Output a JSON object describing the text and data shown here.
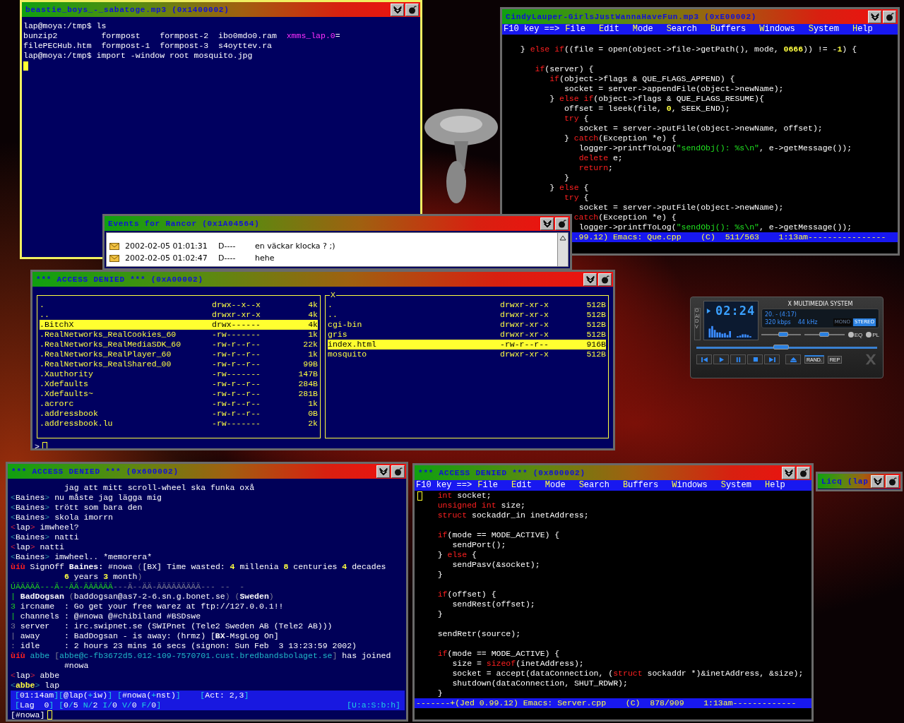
{
  "windows": [
    {
      "kind": "terminal",
      "title": "beastie_boys_-_sabatoge.mp3 (0x1400002)",
      "focused": true,
      "cursor": true,
      "lines": [
        {
          "parts": [
            {
              "kind": "plain",
              "text": "lap@moya:/tmp$ ls"
            }
          ]
        },
        {
          "parts": [
            {
              "kind": "plain",
              "text": "bunzip2         formpost    formpost-2  ibo0mdo0.ram  "
            },
            {
              "kind": "magenta",
              "text": "xmms_lap.0"
            },
            {
              "kind": "plain",
              "text": "="
            }
          ]
        },
        {
          "parts": [
            {
              "kind": "plain",
              "text": "filePECHub.htm  formpost-1  formpost-3  s4oyttev.ra"
            }
          ]
        },
        {
          "parts": [
            {
              "kind": "plain",
              "text": "lap@moya:/tmp$ import -window root mosquito.jpg"
            }
          ]
        }
      ]
    },
    {
      "kind": "editor",
      "title": "CindyLauper-GirlsJustWannaHaveFun.mp3 (0xE00002)",
      "focused": false,
      "menu_prefix": "F10 key ==>",
      "menu": [
        "File",
        "Edit",
        "Mode",
        "Search",
        "Buffers",
        "Windows",
        "System",
        "Help"
      ],
      "lines": [
        {
          "parts": [
            {
              "kind": "plain",
              "text": "  } "
            },
            {
              "kind": "kw",
              "text": "else if"
            },
            {
              "kind": "plain",
              "text": "((file = open(object->file->getPath(), mode, "
            },
            {
              "kind": "num",
              "text": "0666"
            },
            {
              "kind": "plain",
              "text": ")) != -"
            },
            {
              "kind": "num",
              "text": "1"
            },
            {
              "kind": "plain",
              "text": ") {"
            }
          ]
        },
        {
          "gap": true,
          "parts": [
            {
              "kind": "kw",
              "text": "     if"
            },
            {
              "kind": "plain",
              "text": "(server) {"
            }
          ]
        },
        {
          "parts": [
            {
              "kind": "kw",
              "text": "        if"
            },
            {
              "kind": "plain",
              "text": "(object->flags & QUE_FLAGS_APPEND) {"
            }
          ]
        },
        {
          "parts": [
            {
              "kind": "plain",
              "text": "           socket = server->appendFile(object->newName);"
            }
          ]
        },
        {
          "parts": [
            {
              "kind": "plain",
              "text": "        } "
            },
            {
              "kind": "kw",
              "text": "else if"
            },
            {
              "kind": "plain",
              "text": "(object->flags & QUE_FLAGS_RESUME){"
            }
          ]
        },
        {
          "parts": [
            {
              "kind": "plain",
              "text": "           offset = lseek(file, "
            },
            {
              "kind": "num",
              "text": "0"
            },
            {
              "kind": "plain",
              "text": ", SEEK_END);"
            }
          ]
        },
        {
          "parts": [
            {
              "kind": "kw",
              "text": "           try"
            },
            {
              "kind": "plain",
              "text": " {"
            }
          ]
        },
        {
          "parts": [
            {
              "kind": "plain",
              "text": "              socket = server->putFile(object->newName, offset);"
            }
          ]
        },
        {
          "parts": [
            {
              "kind": "plain",
              "text": "           } "
            },
            {
              "kind": "kw",
              "text": "catch"
            },
            {
              "kind": "plain",
              "text": "(Exception *e) {"
            }
          ]
        },
        {
          "parts": [
            {
              "kind": "plain",
              "text": "              logger->printfToLog("
            },
            {
              "kind": "str",
              "text": "\"sendObj(): %s\\n\""
            },
            {
              "kind": "plain",
              "text": ", e->getMessage());"
            }
          ]
        },
        {
          "parts": [
            {
              "kind": "kw",
              "text": "              delete"
            },
            {
              "kind": "plain",
              "text": " e;"
            }
          ]
        },
        {
          "parts": [
            {
              "kind": "kw",
              "text": "              return"
            },
            {
              "kind": "plain",
              "text": ";"
            }
          ]
        },
        {
          "parts": [
            {
              "kind": "plain",
              "text": "           }"
            }
          ]
        },
        {
          "parts": [
            {
              "kind": "plain",
              "text": "        } "
            },
            {
              "kind": "kw",
              "text": "else"
            },
            {
              "kind": "plain",
              "text": " {"
            }
          ]
        },
        {
          "parts": [
            {
              "kind": "kw",
              "text": "           try"
            },
            {
              "kind": "plain",
              "text": " {"
            }
          ]
        },
        {
          "parts": [
            {
              "kind": "plain",
              "text": "              socket = server->putFile(object->newName);"
            }
          ]
        },
        {
          "parts": [
            {
              "kind": "kw",
              "text": "             catch"
            },
            {
              "kind": "plain",
              "text": "(Exception *e) {"
            }
          ]
        },
        {
          "parts": [
            {
              "kind": "plain",
              "text": "              logger->printfToLog("
            },
            {
              "kind": "str",
              "text": "\"sendObj(): %s\\n\""
            },
            {
              "kind": "plain",
              "text": ", e->getMessage());"
            }
          ]
        }
      ],
      "status": "             .99.12) Emacs: Que.cpp    (C)  511/563    1:13am----------------"
    },
    {
      "kind": "events",
      "title": "Events for Rancor (0x1A04564)",
      "focused": false,
      "rows": [
        {
          "date": "2002-02-05 01:01:31",
          "flags": "D----",
          "message": "en väckar klocka ? ;)",
          "selected": false
        },
        {
          "date": "2002-02-05 01:02:47",
          "flags": "D----",
          "message": "hehe",
          "selected": false
        }
      ]
    },
    {
      "kind": "filemanager",
      "title": "*** ACCESS DENIED *** (0xA00002)",
      "focused": false,
      "cursor": true,
      "prompt": ">",
      "panels": [
        {
          "rows": [
            {
              "name": ".",
              "perms": "drwx--x--x",
              "size": "4k",
              "selected": false
            },
            {
              "name": "..",
              "perms": "drwxr-xr-x",
              "size": "4k",
              "selected": false
            },
            {
              "name": ".BitchX",
              "perms": "drwx------",
              "size": "4k",
              "selected": true
            },
            {
              "name": ".RealNetworks_RealCookies_60",
              "perms": "-rw-------",
              "size": "1k",
              "selected": false
            },
            {
              "name": ".RealNetworks_RealMediaSDK_60",
              "perms": "-rw-r--r--",
              "size": "22k",
              "selected": false
            },
            {
              "name": ".RealNetworks_RealPlayer_60",
              "perms": "-rw-r--r--",
              "size": "1k",
              "selected": false
            },
            {
              "name": ".RealNetworks_RealShared_00",
              "perms": "-rw-r--r--",
              "size": "99B",
              "selected": false
            },
            {
              "name": ".Xauthority",
              "perms": "-rw-------",
              "size": "147B",
              "selected": false
            },
            {
              "name": ".Xdefaults",
              "perms": "-rw-r--r--",
              "size": "284B",
              "selected": false
            },
            {
              "name": ".Xdefaults~",
              "perms": "-rw-r--r--",
              "size": "281B",
              "selected": false
            },
            {
              "name": ".acrorc",
              "perms": "-rw-r--r--",
              "size": "1k",
              "selected": false
            },
            {
              "name": ".addressbook",
              "perms": "-rw-r--r--",
              "size": "0B",
              "selected": false
            },
            {
              "name": ".addressbook.lu",
              "perms": "-rw-------",
              "size": "2k",
              "selected": false
            }
          ]
        },
        {
          "title": "X",
          "rows": [
            {
              "name": ".",
              "perms": "drwxr-xr-x",
              "size": "512B",
              "selected": false
            },
            {
              "name": "..",
              "perms": "drwxr-xr-x",
              "size": "512B",
              "selected": false
            },
            {
              "name": "cgi-bin",
              "perms": "drwxr-xr-x",
              "size": "512B",
              "selected": false
            },
            {
              "name": "gris",
              "perms": "drwxr-xr-x",
              "size": "512B",
              "selected": false
            },
            {
              "name": "index.html",
              "perms": "-rw-r--r--",
              "size": "916B",
              "selected": true
            },
            {
              "name": "mosquito",
              "perms": "drwxr-xr-x",
              "size": "512B",
              "selected": false
            }
          ]
        }
      ]
    },
    {
      "kind": "player",
      "title": "X MULTIMEDIA SYSTEM",
      "side_label": "OAIDV",
      "time": "02:24",
      "track": "20.  -  (4:17)",
      "bitrate": "320 kbps",
      "samplerate": "44 kHz",
      "modes": [
        {
          "label": "MONO",
          "on": false
        },
        {
          "label": "STEREO",
          "on": true
        }
      ],
      "sliders": [
        {
          "kind": "volume",
          "level": 0.55
        },
        {
          "kind": "balance",
          "level": 0.5
        },
        {
          "kind": "seek",
          "level": 0.47
        }
      ],
      "toggles": [
        {
          "label": "EQ",
          "on": false
        },
        {
          "label": "PL",
          "on": false
        }
      ],
      "switches": [
        {
          "label": "RAND.",
          "on": true
        },
        {
          "label": "REP",
          "on": false
        }
      ]
    },
    {
      "kind": "irc",
      "title": "*** ACCESS DENIED *** (0x600002)",
      "focused": false,
      "cursor": true,
      "lines": [
        {
          "parts": [
            {
              "kind": "plain",
              "text": "           jag att mitt scroll-wheel ska funka oxå"
            }
          ]
        },
        {
          "parts": [
            {
              "kind": "bracket",
              "text": "<"
            },
            {
              "kind": "plain",
              "text": "Baines"
            },
            {
              "kind": "bracket",
              "text": ">"
            },
            {
              "kind": "plain",
              "text": " nu måste jag lägga mig"
            }
          ]
        },
        {
          "parts": [
            {
              "kind": "bracket",
              "text": "<"
            },
            {
              "kind": "plain",
              "text": "Baines"
            },
            {
              "kind": "bracket",
              "text": ">"
            },
            {
              "kind": "plain",
              "text": " trött som bara den"
            }
          ]
        },
        {
          "parts": [
            {
              "kind": "bracket",
              "text": "<"
            },
            {
              "kind": "plain",
              "text": "Baines"
            },
            {
              "kind": "bracket",
              "text": ">"
            },
            {
              "kind": "plain",
              "text": " skola imorrn"
            }
          ]
        },
        {
          "parts": [
            {
              "kind": "mebracket",
              "text": "<"
            },
            {
              "kind": "plain",
              "text": "lap"
            },
            {
              "kind": "mebracket",
              "text": ">"
            },
            {
              "kind": "plain",
              "text": " imwheel?"
            }
          ]
        },
        {
          "parts": [
            {
              "kind": "bracket",
              "text": "<"
            },
            {
              "kind": "plain",
              "text": "Baines"
            },
            {
              "kind": "bracket",
              "text": ">"
            },
            {
              "kind": "plain",
              "text": " natti"
            }
          ]
        },
        {
          "parts": [
            {
              "kind": "mebracket",
              "text": "<"
            },
            {
              "kind": "plain",
              "text": "lap"
            },
            {
              "kind": "mebracket",
              "text": ">"
            },
            {
              "kind": "plain",
              "text": " natti"
            }
          ]
        },
        {
          "parts": [
            {
              "kind": "bracket",
              "text": "<"
            },
            {
              "kind": "plain",
              "text": "Baines"
            },
            {
              "kind": "bracket",
              "text": ">"
            },
            {
              "kind": "plain",
              "text": " imwheel.. *memorera*"
            }
          ]
        },
        {
          "parts": [
            {
              "kind": "alert",
              "text": "ùíù"
            },
            {
              "kind": "plain",
              "text": " SignOff "
            },
            {
              "kind": "bold",
              "text": "Baines:"
            },
            {
              "kind": "plain",
              "text": " #nowa "
            },
            {
              "kind": "dim",
              "text": "("
            },
            {
              "kind": "plain",
              "text": "[BX] Time wasted: "
            },
            {
              "kind": "num",
              "text": "4"
            },
            {
              "kind": "plain",
              "text": " millenia "
            },
            {
              "kind": "num",
              "text": "8"
            },
            {
              "kind": "plain",
              "text": " centuries "
            },
            {
              "kind": "num",
              "text": "4"
            },
            {
              "kind": "plain",
              "text": " decades"
            }
          ]
        },
        {
          "parts": [
            {
              "kind": "num",
              "text": "           6"
            },
            {
              "kind": "plain",
              "text": " years "
            },
            {
              "kind": "num",
              "text": "3"
            },
            {
              "kind": "plain",
              "text": " month"
            },
            {
              "kind": "dim",
              "text": ")"
            }
          ]
        },
        {
          "parts": [
            {
              "kind": "rule",
              "text": "ÚÄÄÄÄÄ---Ä--ÄÄ-ÄÄÄÄÄÄ"
            },
            {
              "kind": "dim",
              "text": "---Ä--ÄÄ-ÄÄÄÄÄÄÄÄÄ--- --  -"
            }
          ]
        },
        {
          "parts": [
            {
              "kind": "rule",
              "text": "| "
            },
            {
              "kind": "bold",
              "text": "BadDogsan"
            },
            {
              "kind": "dim",
              "text": " ("
            },
            {
              "kind": "plain",
              "text": "baddogsan@as7-2-6.sn.g.bonet.se"
            },
            {
              "kind": "dim",
              "text": ") ("
            },
            {
              "kind": "bold",
              "text": "Sweden"
            },
            {
              "kind": "dim",
              "text": ")"
            }
          ]
        },
        {
          "parts": [
            {
              "kind": "rule",
              "text": "3 "
            },
            {
              "kind": "plain",
              "text": "ircname  : Go get your free warez at ftp://127.0.0.1!!"
            }
          ]
        },
        {
          "parts": [
            {
              "kind": "rule",
              "text": "| "
            },
            {
              "kind": "plain",
              "text": "channels : @#nowa @#chibiland #BSDswe"
            }
          ]
        },
        {
          "parts": [
            {
              "kind": "dim",
              "text": "3 "
            },
            {
              "kind": "plain",
              "text": "server   : irc.swipnet.se (SWIPnet (Tele2 Sweden AB (Tele2 AB)))"
            }
          ]
        },
        {
          "parts": [
            {
              "kind": "dim",
              "text": "| "
            },
            {
              "kind": "plain",
              "text": "away     : BadDogsan - is away: (hrmz) ["
            },
            {
              "kind": "bold",
              "text": "BX"
            },
            {
              "kind": "plain",
              "text": "-MsgLog On]"
            }
          ]
        },
        {
          "parts": [
            {
              "kind": "dim",
              "text": ": "
            },
            {
              "kind": "plain",
              "text": "idle     : 2 hours 23 mins 16 secs (signon: Sun Feb  3 13:23:59 2002)"
            }
          ]
        },
        {
          "parts": [
            {
              "kind": "alert",
              "text": "ùíù"
            },
            {
              "kind": "host",
              "text": " abbe"
            },
            {
              "kind": "dim",
              "text": " ["
            },
            {
              "kind": "host",
              "text": "abbe@c-fb3672d5.012-109-7570701.cust.bredbandsbolaget.se"
            },
            {
              "kind": "dim",
              "text": "]"
            },
            {
              "kind": "plain",
              "text": " has joined"
            }
          ]
        },
        {
          "parts": [
            {
              "kind": "plain",
              "text": "           #nowa"
            }
          ]
        },
        {
          "parts": [
            {
              "kind": "mebracket",
              "text": "<"
            },
            {
              "kind": "plain",
              "text": "lap"
            },
            {
              "kind": "mebracket",
              "text": ">"
            },
            {
              "kind": "plain",
              "text": " abbe"
            }
          ]
        },
        {
          "parts": [
            {
              "kind": "bracket",
              "text": "<"
            },
            {
              "kind": "mynick",
              "text": "abbe"
            },
            {
              "kind": "bracket",
              "text": ">"
            },
            {
              "kind": "plain",
              "text": " lap"
            }
          ]
        }
      ],
      "status": [
        {
          "parts": [
            {
              "kind": "sbr",
              "text": "["
            },
            {
              "kind": "plain",
              "text": "01:14am"
            },
            {
              "kind": "sbr",
              "text": "]["
            },
            {
              "kind": "plain",
              "text": "@lap("
            },
            {
              "kind": "sbr",
              "text": "+"
            },
            {
              "kind": "plain",
              "text": "iw)"
            },
            {
              "kind": "sbr",
              "text": "] ["
            },
            {
              "kind": "plain",
              "text": "#nowa("
            },
            {
              "kind": "sbr",
              "text": "+"
            },
            {
              "kind": "plain",
              "text": "nst)"
            },
            {
              "kind": "sbr",
              "text": "]    ["
            },
            {
              "kind": "plain",
              "text": "Act: 2,3"
            },
            {
              "kind": "sbr",
              "text": "]"
            }
          ]
        },
        {
          "parts": [
            {
              "kind": "sbr",
              "text": "["
            },
            {
              "kind": "plain",
              "text": "Lag  0"
            },
            {
              "kind": "sbr",
              "text": "] ["
            },
            {
              "kind": "plain",
              "text": "0"
            },
            {
              "kind": "sbr",
              "text": "/"
            },
            {
              "kind": "plain",
              "text": "5 "
            },
            {
              "kind": "sbr",
              "text": "N/"
            },
            {
              "kind": "plain",
              "text": "2 "
            },
            {
              "kind": "sbr",
              "text": "I/"
            },
            {
              "kind": "plain",
              "text": "0 "
            },
            {
              "kind": "sbr",
              "text": "V/"
            },
            {
              "kind": "plain",
              "text": "0 "
            },
            {
              "kind": "sbr",
              "text": "F/"
            },
            {
              "kind": "plain",
              "text": "0"
            },
            {
              "kind": "sbr",
              "text": "]"
            }
          ],
          "right": "[U:a:S:b:h]"
        }
      ],
      "input": "[#nowa]"
    },
    {
      "kind": "editor",
      "title": "*** ACCESS DENIED *** (0x800002)",
      "focused": false,
      "cursor": true,
      "menu_prefix": "F10 key ==>",
      "menu": [
        "File",
        "Edit",
        "Mode",
        "Search",
        "Buffers",
        "Windows",
        "System",
        "Help"
      ],
      "lines": [
        {
          "parts": [
            {
              "kind": "kw",
              "text": "   int"
            },
            {
              "kind": "plain",
              "text": " socket;"
            }
          ]
        },
        {
          "parts": [
            {
              "kind": "kw",
              "text": "   unsigned int"
            },
            {
              "kind": "plain",
              "text": " size;"
            }
          ]
        },
        {
          "parts": [
            {
              "kind": "kw",
              "text": "   struct"
            },
            {
              "kind": "plain",
              "text": " sockaddr_in inetAddress;"
            }
          ]
        },
        {
          "gap": true,
          "parts": [
            {
              "kind": "kw",
              "text": "   if"
            },
            {
              "kind": "plain",
              "text": "(mode == MODE_ACTIVE) {"
            }
          ]
        },
        {
          "parts": [
            {
              "kind": "plain",
              "text": "      sendPort();"
            }
          ]
        },
        {
          "parts": [
            {
              "kind": "plain",
              "text": "   } "
            },
            {
              "kind": "kw",
              "text": "else"
            },
            {
              "kind": "plain",
              "text": " {"
            }
          ]
        },
        {
          "parts": [
            {
              "kind": "plain",
              "text": "      sendPasv(&socket);"
            }
          ]
        },
        {
          "parts": [
            {
              "kind": "plain",
              "text": "   }"
            }
          ]
        },
        {
          "gap": true,
          "parts": [
            {
              "kind": "kw",
              "text": "   if"
            },
            {
              "kind": "plain",
              "text": "(offset) {"
            }
          ]
        },
        {
          "parts": [
            {
              "kind": "plain",
              "text": "      sendRest(offset);"
            }
          ]
        },
        {
          "parts": [
            {
              "kind": "plain",
              "text": "   }"
            }
          ]
        },
        {
          "gap": true,
          "parts": [
            {
              "kind": "plain",
              "text": "   sendRetr(source);"
            }
          ]
        },
        {
          "gap": true,
          "parts": [
            {
              "kind": "kw",
              "text": "   if"
            },
            {
              "kind": "plain",
              "text": "(mode == MODE_ACTIVE) {"
            }
          ]
        },
        {
          "parts": [
            {
              "kind": "plain",
              "text": "      size = "
            },
            {
              "kind": "kw",
              "text": "sizeof"
            },
            {
              "kind": "plain",
              "text": "(inetAddress);"
            }
          ]
        },
        {
          "parts": [
            {
              "kind": "plain",
              "text": "      socket = accept(dataConnection, ("
            },
            {
              "kind": "kw",
              "text": "struct"
            },
            {
              "kind": "plain",
              "text": " sockaddr *)&inetAddress, &size);"
            }
          ]
        },
        {
          "parts": [
            {
              "kind": "plain",
              "text": "      shutdown(dataConnection, SHUT_RDWR);"
            }
          ]
        },
        {
          "parts": [
            {
              "kind": "plain",
              "text": "   }"
            }
          ]
        }
      ],
      "status": "-------+(Jed 0.99.12) Emacs: Server.cpp    (C)  878/909    1:13am-------------"
    },
    {
      "kind": "stub",
      "title": "Licq (lap",
      "focused": false
    }
  ]
}
